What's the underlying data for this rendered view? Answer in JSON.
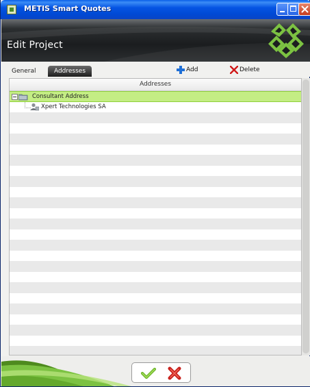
{
  "window": {
    "title": "METIS Smart Quotes",
    "app_icon": "metis-app-icon",
    "controls": [
      "minimize-icon",
      "maximize-icon",
      "close-icon"
    ]
  },
  "header": {
    "title": "Edit Project",
    "logo": "metis-logo-icon"
  },
  "tabs": [
    {
      "label": "General",
      "active": false
    },
    {
      "label": "Addresses",
      "active": true
    }
  ],
  "actions": {
    "add_label": "Add",
    "add_icon": "plus-icon",
    "delete_label": "Delete",
    "delete_icon": "x-icon"
  },
  "grid": {
    "column_header": "Addresses",
    "rows": [
      {
        "label": "Consultant Address",
        "level": 0,
        "expanded": true,
        "icon": "folder-icon",
        "selected": true
      },
      {
        "label": "Xpert Technologies SA",
        "level": 1,
        "icon": "person-icon",
        "selected": false
      }
    ]
  },
  "footer": {
    "ok_icon": "checkmark-icon",
    "cancel_icon": "cancel-x-icon"
  },
  "colors": {
    "selected_row": "#c4ed84",
    "header_dark": "#1b1d1f",
    "accent_green": "#7cc242",
    "title_bar_blue": "#0554e3"
  }
}
